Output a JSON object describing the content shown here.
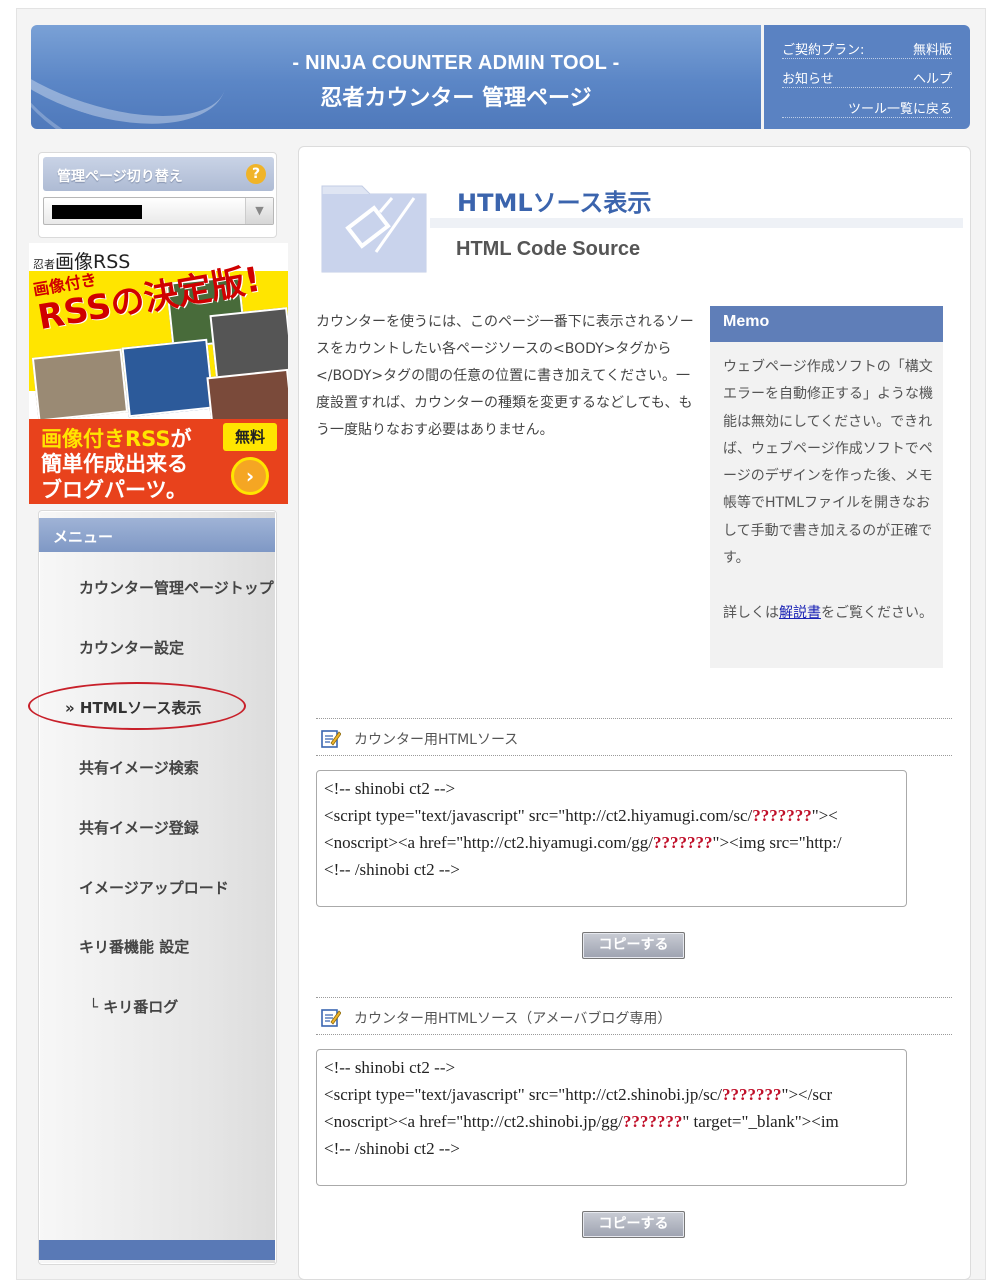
{
  "header": {
    "title_en": "- NINJA COUNTER ADMIN TOOL -",
    "title_jp": "忍者カウンター 管理ページ",
    "plan_label": "ご契約プラン:",
    "plan_value": "無料版",
    "news_link": "お知らせ",
    "help_link": "ヘルプ",
    "back_link": "ツール一覧に戻る"
  },
  "sidebar": {
    "switch_title": "管理ページ切り替え",
    "switch_help": "?",
    "select_arrow": "▼",
    "banner": {
      "brand_small": "忍者",
      "brand": "画像RSS",
      "slogan1": "画像付き",
      "slogan2": "RSSの決定版!",
      "line1_hl": "画像付きRSS",
      "line1_tail": "が",
      "line2": "簡単作成出来る",
      "line3": "ブログパーツ。",
      "free": "無料",
      "go": "›"
    },
    "menu_title": "メニュー",
    "menu_items": [
      {
        "label": "カウンター管理ページトップ"
      },
      {
        "label": "カウンター設定"
      },
      {
        "label": "» HTMLソース表示"
      },
      {
        "label": "共有イメージ検索"
      },
      {
        "label": "共有イメージ登録"
      },
      {
        "label": "イメージアップロード"
      },
      {
        "label": "キリ番機能 設定"
      },
      {
        "label": "└ キリ番ログ"
      }
    ]
  },
  "main": {
    "title": "HTMLソース表示",
    "subtitle": "HTML Code Source",
    "intro": "カウンターを使うには、このページ一番下に表示されるソースをカウントしたい各ページソースの<BODY>タグから</BODY>タグの間の任意の位置に書き加えてください。一度設置すれば、カウンターの種類を変更するなどしても、もう一度貼りなおす必要はありません。",
    "memo": {
      "title": "Memo",
      "body": "ウェブページ作成ソフトの「構文エラーを自動修正する」ような機能は無効にしてください。できれば、ウェブページ作成ソフトでページのデザインを作った後、メモ帳等でHTMLファイルを開きなおして手動で書き加えるのが正確です。",
      "more_before": "詳しくは",
      "more_link": "解説書",
      "more_after": "をご覧ください。"
    },
    "sections": [
      {
        "label": "カウンター用HTMLソース",
        "lines": [
          {
            "pre": "<!-- shinobi ct2 -->",
            "q": "",
            "post": ""
          },
          {
            "pre": "<script type=\"text/javascript\" src=\"http://ct2.hiyamugi.com/sc/",
            "q": "???????",
            "post": "\"><"
          },
          {
            "pre": "<noscript><a href=\"http://ct2.hiyamugi.com/gg/",
            "q": "???????",
            "post": "\"><img src=\"http:/"
          },
          {
            "pre": "<!-- /shinobi ct2 -->",
            "q": "",
            "post": ""
          }
        ],
        "button": "コピーする"
      },
      {
        "label": "カウンター用HTMLソース（アメーバブログ専用）",
        "lines": [
          {
            "pre": "<!-- shinobi ct2 -->",
            "q": "",
            "post": ""
          },
          {
            "pre": "<script type=\"text/javascript\" src=\"http://ct2.shinobi.jp/sc/",
            "q": "???????",
            "post": "\"></scr"
          },
          {
            "pre": "<noscript><a href=\"http://ct2.shinobi.jp/gg/",
            "q": "???????",
            "post": "\" target=\"_blank\"><im"
          },
          {
            "pre": "<!-- /shinobi ct2 -->",
            "q": "",
            "post": ""
          }
        ],
        "button": "コピーする"
      }
    ]
  },
  "colors": {
    "header_blue": "#5b86c6",
    "title_blue": "#3b64ad",
    "memo_head": "#5f7eb8",
    "placeholder_red": "#c0102a",
    "highlight_circle": "#c8202a"
  },
  "icons": {
    "help": "question-icon",
    "section": "edit-icon",
    "title": "folder-icon"
  }
}
